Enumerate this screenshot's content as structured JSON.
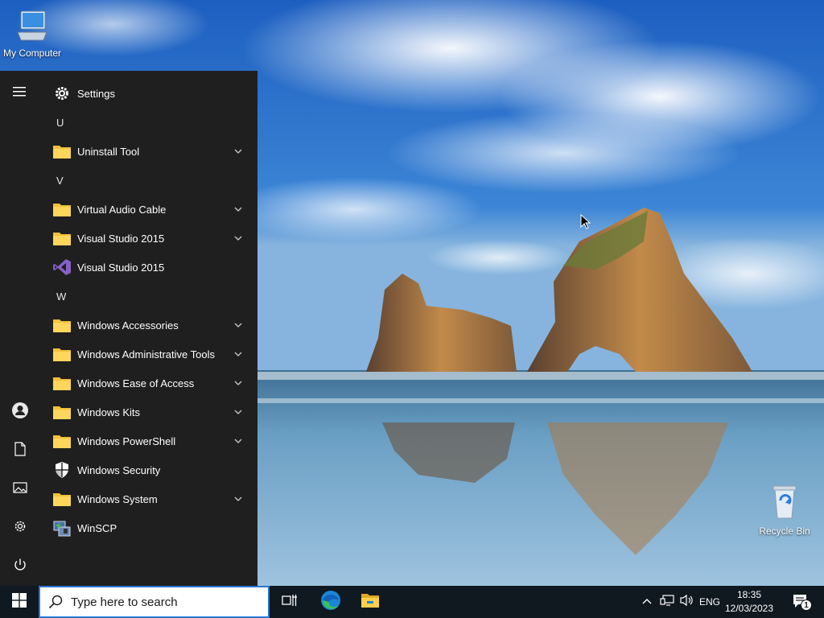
{
  "desktop": {
    "icons": [
      {
        "label": "My Computer",
        "icon": "computer-icon"
      },
      {
        "label": "Recycle Bin",
        "icon": "recycle-bin-icon"
      }
    ]
  },
  "start_menu": {
    "rail": [
      {
        "icon": "hamburger-menu-icon"
      },
      {
        "icon": "user-account-icon"
      },
      {
        "icon": "documents-icon"
      },
      {
        "icon": "pictures-icon"
      },
      {
        "icon": "settings-icon"
      },
      {
        "icon": "power-icon"
      }
    ],
    "items": [
      {
        "type": "app",
        "label": "Settings",
        "icon": "gear-icon"
      },
      {
        "type": "letter",
        "label": "U"
      },
      {
        "type": "folder",
        "label": "Uninstall Tool",
        "icon": "folder-icon"
      },
      {
        "type": "letter",
        "label": "V"
      },
      {
        "type": "folder",
        "label": "Virtual Audio Cable",
        "icon": "folder-icon"
      },
      {
        "type": "folder",
        "label": "Visual Studio 2015",
        "icon": "folder-icon"
      },
      {
        "type": "app",
        "label": "Visual Studio 2015",
        "icon": "visual-studio-icon"
      },
      {
        "type": "letter",
        "label": "W"
      },
      {
        "type": "folder",
        "label": "Windows Accessories",
        "icon": "folder-icon"
      },
      {
        "type": "folder",
        "label": "Windows Administrative Tools",
        "icon": "folder-icon"
      },
      {
        "type": "folder",
        "label": "Windows Ease of Access",
        "icon": "folder-icon"
      },
      {
        "type": "folder",
        "label": "Windows Kits",
        "icon": "folder-icon"
      },
      {
        "type": "folder",
        "label": "Windows PowerShell",
        "icon": "folder-icon"
      },
      {
        "type": "app",
        "label": "Windows Security",
        "icon": "shield-icon"
      },
      {
        "type": "folder",
        "label": "Windows System",
        "icon": "folder-icon"
      },
      {
        "type": "app",
        "label": "WinSCP",
        "icon": "winscp-icon"
      }
    ]
  },
  "taskbar": {
    "search_placeholder": "Type here to search",
    "pinned": [
      {
        "icon": "task-view-icon"
      },
      {
        "icon": "edge-icon"
      },
      {
        "icon": "file-explorer-icon"
      }
    ],
    "tray": {
      "language": "ENG",
      "time": "18:35",
      "date": "12/03/2023",
      "notification_count": "1"
    }
  },
  "colors": {
    "menu_bg": "#1f1f1f",
    "taskbar_bg": "#101820",
    "folder": "#f3c13a",
    "search_border": "#2a78d4"
  }
}
